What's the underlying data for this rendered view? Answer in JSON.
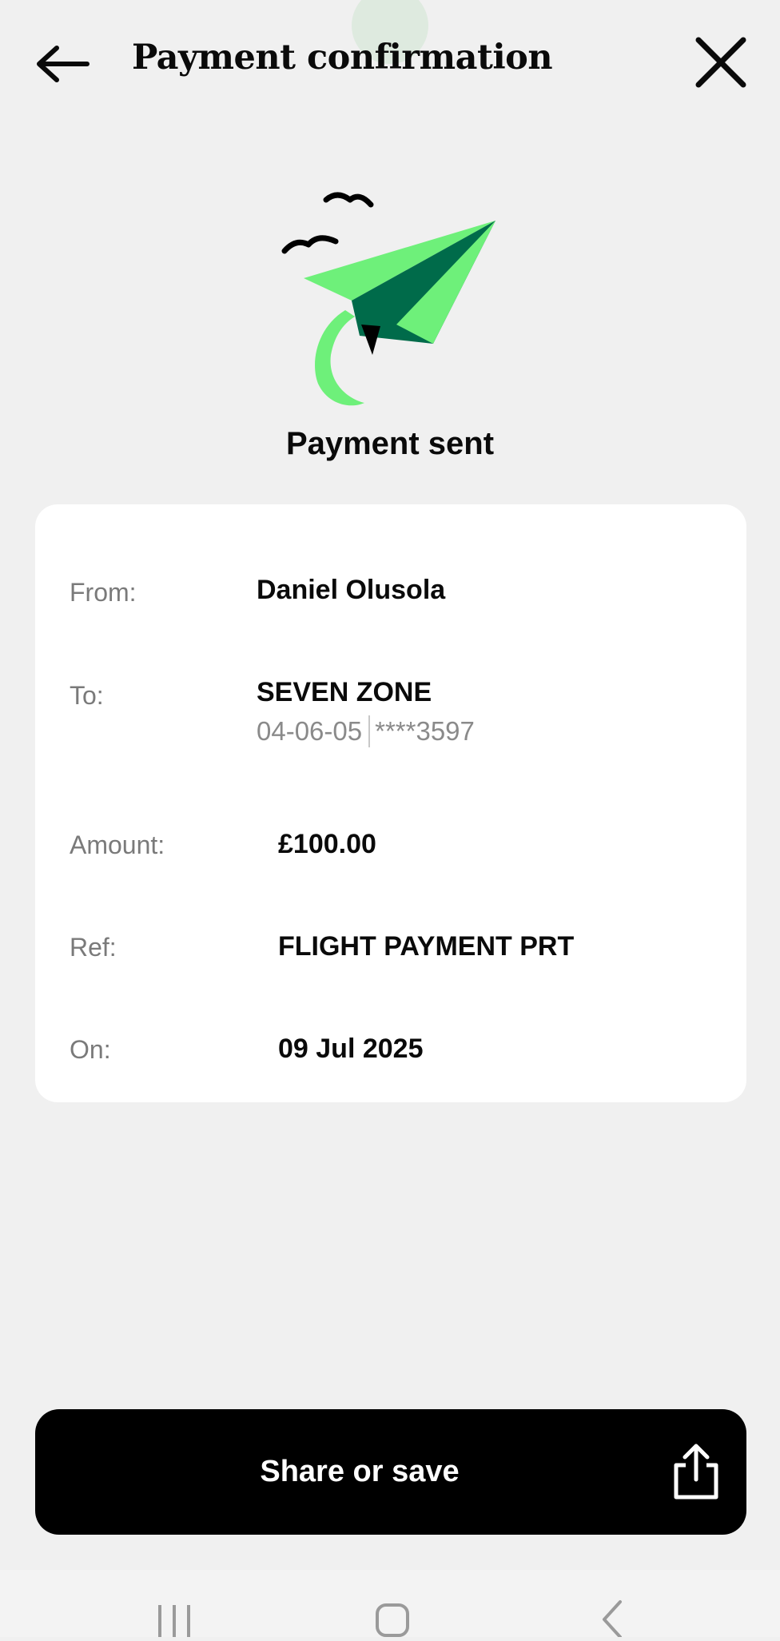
{
  "header": {
    "title": "Payment confirmation",
    "back_icon": "arrow-left-icon",
    "close_icon": "close-icon"
  },
  "status": {
    "label": "Payment sent",
    "illustration": "paper-plane-illustration"
  },
  "details": {
    "from": {
      "label": "From:",
      "value": "Daniel Olusola"
    },
    "to": {
      "label": "To:",
      "value": "SEVEN ZONE",
      "sort_code": "04-06-05",
      "account": "****3597"
    },
    "amount": {
      "label": "Amount:",
      "value": "£100.00"
    },
    "ref": {
      "label": "Ref:",
      "value": "FLIGHT PAYMENT PRT"
    },
    "on": {
      "label": "On:",
      "value": "09 Jul 2025"
    }
  },
  "actions": {
    "share_label": "Share or save",
    "share_icon": "share-icon"
  },
  "navbar": {
    "recents_icon": "recents-icon",
    "home_icon": "home-icon",
    "back_icon": "back-chevron-icon"
  },
  "colors": {
    "background": "#f0f0f0",
    "card": "#ffffff",
    "plane_light": "#6ef07a",
    "plane_dark": "#006b4a",
    "button": "#000000"
  }
}
